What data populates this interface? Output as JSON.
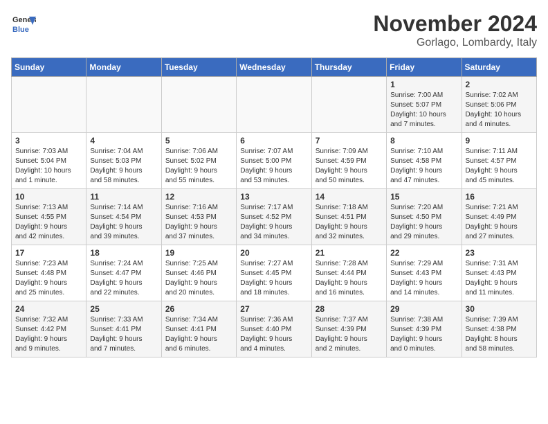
{
  "header": {
    "logo_line1": "General",
    "logo_line2": "Blue",
    "month": "November 2024",
    "location": "Gorlago, Lombardy, Italy"
  },
  "weekdays": [
    "Sunday",
    "Monday",
    "Tuesday",
    "Wednesday",
    "Thursday",
    "Friday",
    "Saturday"
  ],
  "weeks": [
    [
      {
        "day": "",
        "info": ""
      },
      {
        "day": "",
        "info": ""
      },
      {
        "day": "",
        "info": ""
      },
      {
        "day": "",
        "info": ""
      },
      {
        "day": "",
        "info": ""
      },
      {
        "day": "1",
        "info": "Sunrise: 7:00 AM\nSunset: 5:07 PM\nDaylight: 10 hours\nand 7 minutes."
      },
      {
        "day": "2",
        "info": "Sunrise: 7:02 AM\nSunset: 5:06 PM\nDaylight: 10 hours\nand 4 minutes."
      }
    ],
    [
      {
        "day": "3",
        "info": "Sunrise: 7:03 AM\nSunset: 5:04 PM\nDaylight: 10 hours\nand 1 minute."
      },
      {
        "day": "4",
        "info": "Sunrise: 7:04 AM\nSunset: 5:03 PM\nDaylight: 9 hours\nand 58 minutes."
      },
      {
        "day": "5",
        "info": "Sunrise: 7:06 AM\nSunset: 5:02 PM\nDaylight: 9 hours\nand 55 minutes."
      },
      {
        "day": "6",
        "info": "Sunrise: 7:07 AM\nSunset: 5:00 PM\nDaylight: 9 hours\nand 53 minutes."
      },
      {
        "day": "7",
        "info": "Sunrise: 7:09 AM\nSunset: 4:59 PM\nDaylight: 9 hours\nand 50 minutes."
      },
      {
        "day": "8",
        "info": "Sunrise: 7:10 AM\nSunset: 4:58 PM\nDaylight: 9 hours\nand 47 minutes."
      },
      {
        "day": "9",
        "info": "Sunrise: 7:11 AM\nSunset: 4:57 PM\nDaylight: 9 hours\nand 45 minutes."
      }
    ],
    [
      {
        "day": "10",
        "info": "Sunrise: 7:13 AM\nSunset: 4:55 PM\nDaylight: 9 hours\nand 42 minutes."
      },
      {
        "day": "11",
        "info": "Sunrise: 7:14 AM\nSunset: 4:54 PM\nDaylight: 9 hours\nand 39 minutes."
      },
      {
        "day": "12",
        "info": "Sunrise: 7:16 AM\nSunset: 4:53 PM\nDaylight: 9 hours\nand 37 minutes."
      },
      {
        "day": "13",
        "info": "Sunrise: 7:17 AM\nSunset: 4:52 PM\nDaylight: 9 hours\nand 34 minutes."
      },
      {
        "day": "14",
        "info": "Sunrise: 7:18 AM\nSunset: 4:51 PM\nDaylight: 9 hours\nand 32 minutes."
      },
      {
        "day": "15",
        "info": "Sunrise: 7:20 AM\nSunset: 4:50 PM\nDaylight: 9 hours\nand 29 minutes."
      },
      {
        "day": "16",
        "info": "Sunrise: 7:21 AM\nSunset: 4:49 PM\nDaylight: 9 hours\nand 27 minutes."
      }
    ],
    [
      {
        "day": "17",
        "info": "Sunrise: 7:23 AM\nSunset: 4:48 PM\nDaylight: 9 hours\nand 25 minutes."
      },
      {
        "day": "18",
        "info": "Sunrise: 7:24 AM\nSunset: 4:47 PM\nDaylight: 9 hours\nand 22 minutes."
      },
      {
        "day": "19",
        "info": "Sunrise: 7:25 AM\nSunset: 4:46 PM\nDaylight: 9 hours\nand 20 minutes."
      },
      {
        "day": "20",
        "info": "Sunrise: 7:27 AM\nSunset: 4:45 PM\nDaylight: 9 hours\nand 18 minutes."
      },
      {
        "day": "21",
        "info": "Sunrise: 7:28 AM\nSunset: 4:44 PM\nDaylight: 9 hours\nand 16 minutes."
      },
      {
        "day": "22",
        "info": "Sunrise: 7:29 AM\nSunset: 4:43 PM\nDaylight: 9 hours\nand 14 minutes."
      },
      {
        "day": "23",
        "info": "Sunrise: 7:31 AM\nSunset: 4:43 PM\nDaylight: 9 hours\nand 11 minutes."
      }
    ],
    [
      {
        "day": "24",
        "info": "Sunrise: 7:32 AM\nSunset: 4:42 PM\nDaylight: 9 hours\nand 9 minutes."
      },
      {
        "day": "25",
        "info": "Sunrise: 7:33 AM\nSunset: 4:41 PM\nDaylight: 9 hours\nand 7 minutes."
      },
      {
        "day": "26",
        "info": "Sunrise: 7:34 AM\nSunset: 4:41 PM\nDaylight: 9 hours\nand 6 minutes."
      },
      {
        "day": "27",
        "info": "Sunrise: 7:36 AM\nSunset: 4:40 PM\nDaylight: 9 hours\nand 4 minutes."
      },
      {
        "day": "28",
        "info": "Sunrise: 7:37 AM\nSunset: 4:39 PM\nDaylight: 9 hours\nand 2 minutes."
      },
      {
        "day": "29",
        "info": "Sunrise: 7:38 AM\nSunset: 4:39 PM\nDaylight: 9 hours\nand 0 minutes."
      },
      {
        "day": "30",
        "info": "Sunrise: 7:39 AM\nSunset: 4:38 PM\nDaylight: 8 hours\nand 58 minutes."
      }
    ]
  ]
}
